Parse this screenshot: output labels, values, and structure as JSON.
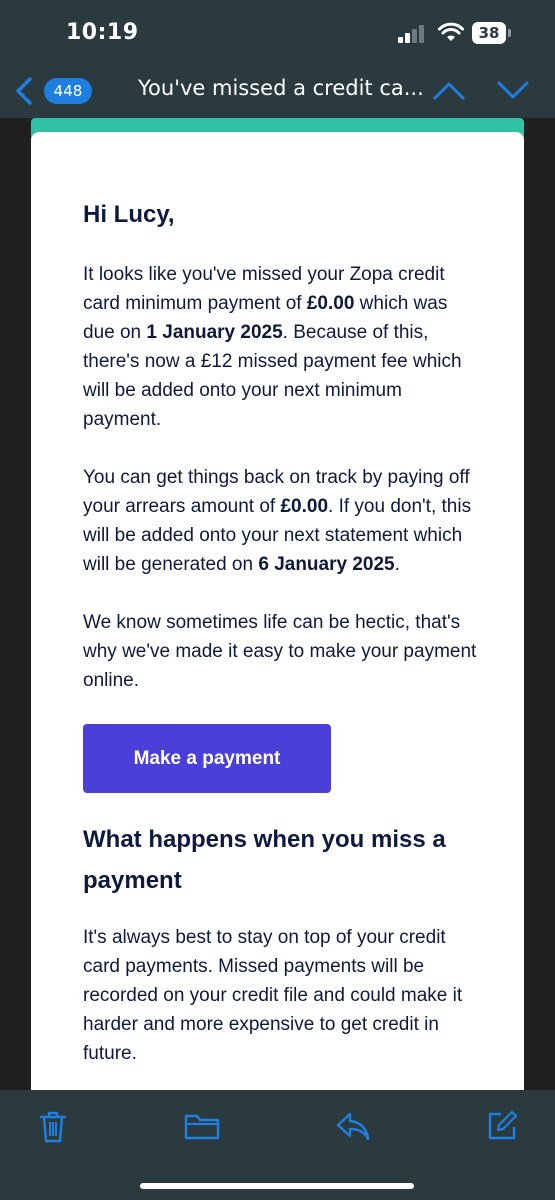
{
  "status_bar": {
    "time": "10:19",
    "battery": "38"
  },
  "nav": {
    "unread_count": "448",
    "subject": "You've missed a credit ca..."
  },
  "email": {
    "greeting": "Hi Lucy,",
    "p1_a": "It looks like you've missed your Zopa credit card minimum payment of ",
    "p1_amount": "£0.00",
    "p1_b": " which was due on ",
    "p1_date": "1 January 2025",
    "p1_c": ". Because of this, there's now a £12 missed payment fee which will be added onto your next minimum payment.",
    "p2_a": "You can get things back on track by paying off your arrears amount of ",
    "p2_amount": "£0.00",
    "p2_b": ". If you don't, this will be added onto your next statement which will be generated on ",
    "p2_date": "6 January 2025",
    "p2_c": ".",
    "p3": "We know sometimes life can be hectic, that's why we've made it easy to make your payment online.",
    "button_label": "Make a payment",
    "section_heading": "What happens when you miss a payment",
    "p4": "It's always best to stay on top of your credit card payments. Missed payments will be recorded on your credit file and could make it harder and more expensive to get credit in future."
  },
  "colors": {
    "chrome": "#2b3a3f",
    "accent_blue": "#1f7fe0",
    "brand_teal": "#2fc2a4",
    "button": "#4a3fd8",
    "text": "#0e1a3d"
  },
  "toolbar": {
    "icons": [
      "trash-icon",
      "folder-icon",
      "reply-icon",
      "compose-icon"
    ]
  }
}
